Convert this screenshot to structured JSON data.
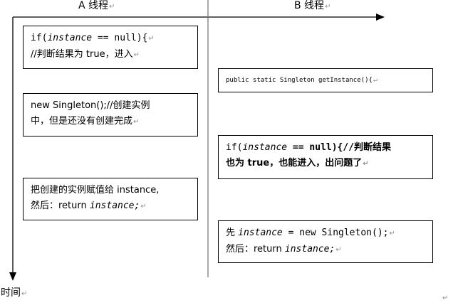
{
  "headers": {
    "a": "A 线程",
    "b": "B 线程",
    "time": "时间"
  },
  "pilcrow": "↵",
  "boxes": {
    "a1": {
      "line1_pre": "if(",
      "line1_var": "instance",
      "line1_post": " == null){",
      "line2": "//判断结果为 true，进入"
    },
    "a2": {
      "line1": "new Singleton();//创建实例",
      "line2": "中，但是还没有创建完成"
    },
    "a3": {
      "line1": "把创建的实例赋值给 instance,",
      "line2_pre": "然后：return ",
      "line2_var": "instance;"
    },
    "b1": {
      "line1": "public static  Singleton getInstance(){"
    },
    "b2": {
      "line1_pre": "if(",
      "line1_var": "instance",
      "line1_post": " == null){//判断结果",
      "line2": "也为 true，也能进入，出问题了"
    },
    "b3": {
      "line1_pre": "先 ",
      "line1_var": "instance",
      "line1_post": " = new Singleton();",
      "line2_pre": "然后：return ",
      "line2_var": "instance;"
    }
  },
  "colors": {
    "line": "#000000",
    "divider": "#707070",
    "pilcrow": "#8c8c8c"
  }
}
